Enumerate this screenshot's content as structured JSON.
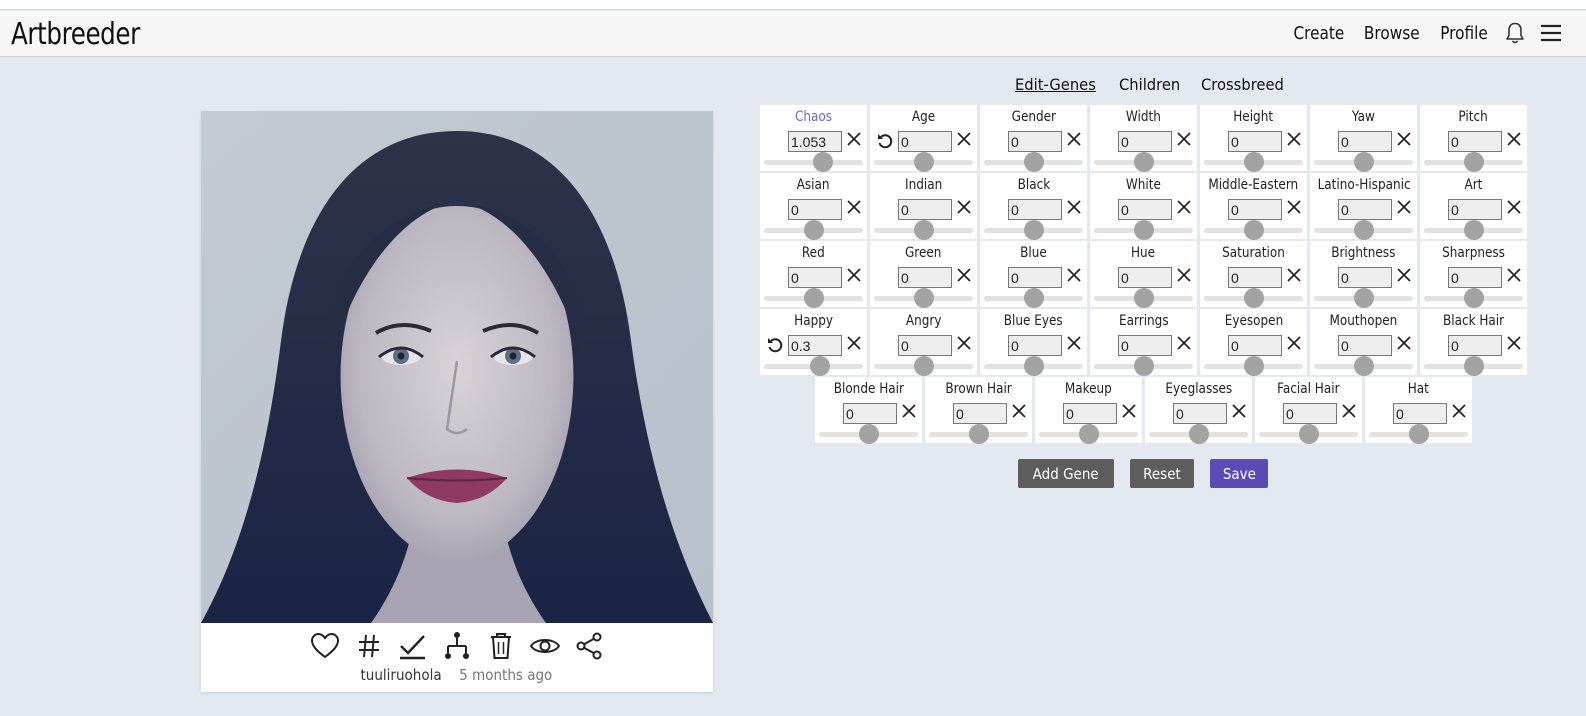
{
  "header": {
    "logo": "Artbreeder",
    "nav": [
      "Create",
      "Browse",
      "Profile"
    ],
    "icons": [
      "bell-icon",
      "hamburger-menu-icon"
    ]
  },
  "card": {
    "author": "tuuliruohola",
    "time": "5 months ago",
    "actions": [
      "heart-icon",
      "hashtag-icon",
      "checkmark-icon",
      "family-tree-icon",
      "trash-icon",
      "eye-icon",
      "share-icon"
    ]
  },
  "tabs": [
    "Edit-Genes",
    "Children",
    "Crossbreed"
  ],
  "genes": [
    {
      "label": "Chaos",
      "value": "1.053",
      "level": 0.6,
      "accent": true
    },
    {
      "label": "Age",
      "value": "0",
      "level": 0.5,
      "undo": true
    },
    {
      "label": "Gender",
      "value": "0",
      "level": 0.5
    },
    {
      "label": "Width",
      "value": "0",
      "level": 0.5
    },
    {
      "label": "Height",
      "value": "0",
      "level": 0.5
    },
    {
      "label": "Yaw",
      "value": "0",
      "level": 0.5
    },
    {
      "label": "Pitch",
      "value": "0",
      "level": 0.5
    },
    {
      "label": "Asian",
      "value": "0",
      "level": 0.5
    },
    {
      "label": "Indian",
      "value": "0",
      "level": 0.5
    },
    {
      "label": "Black",
      "value": "0",
      "level": 0.5
    },
    {
      "label": "White",
      "value": "0",
      "level": 0.5
    },
    {
      "label": "Middle-Eastern",
      "value": "0",
      "level": 0.5
    },
    {
      "label": "Latino-Hispanic",
      "value": "0",
      "level": 0.5
    },
    {
      "label": "Art",
      "value": "0",
      "level": 0.5
    },
    {
      "label": "Red",
      "value": "0",
      "level": 0.5
    },
    {
      "label": "Green",
      "value": "0",
      "level": 0.5
    },
    {
      "label": "Blue",
      "value": "0",
      "level": 0.5
    },
    {
      "label": "Hue",
      "value": "0",
      "level": 0.5
    },
    {
      "label": "Saturation",
      "value": "0",
      "level": 0.5
    },
    {
      "label": "Brightness",
      "value": "0",
      "level": 0.5
    },
    {
      "label": "Sharpness",
      "value": "0",
      "level": 0.5
    },
    {
      "label": "Happy",
      "value": "0.3",
      "level": 0.57,
      "undo": true
    },
    {
      "label": "Angry",
      "value": "0",
      "level": 0.5
    },
    {
      "label": "Blue Eyes",
      "value": "0",
      "level": 0.5
    },
    {
      "label": "Earrings",
      "value": "0",
      "level": 0.5
    },
    {
      "label": "Eyesopen",
      "value": "0",
      "level": 0.5
    },
    {
      "label": "Mouthopen",
      "value": "0",
      "level": 0.5
    },
    {
      "label": "Black Hair",
      "value": "0",
      "level": 0.5
    },
    {
      "label": "Blonde Hair",
      "value": "0",
      "level": 0.5
    },
    {
      "label": "Brown Hair",
      "value": "0",
      "level": 0.5
    },
    {
      "label": "Makeup",
      "value": "0",
      "level": 0.5
    },
    {
      "label": "Eyeglasses",
      "value": "0",
      "level": 0.5
    },
    {
      "label": "Facial Hair",
      "value": "0",
      "level": 0.5
    },
    {
      "label": "Hat",
      "value": "0",
      "level": 0.5
    }
  ],
  "buttons": {
    "add_gene": "Add Gene",
    "reset": "Reset",
    "save": "Save"
  },
  "colors": {
    "background": "#e4e9f1",
    "accent": "#5b4bb5",
    "button_gray": "#5d5d5d"
  }
}
